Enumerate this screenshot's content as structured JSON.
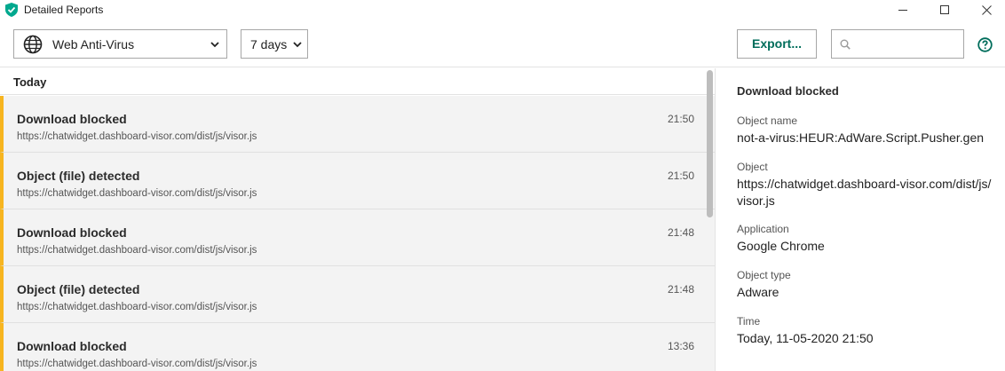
{
  "window": {
    "title": "Detailed Reports"
  },
  "toolbar": {
    "component_selected": "Web Anti-Virus",
    "period_selected": "7 days",
    "export_label": "Export...",
    "search_placeholder": "",
    "search_value": ""
  },
  "list": {
    "group_label": "Today",
    "events": [
      {
        "title": "Download blocked",
        "url": "https://chatwidget.dashboard-visor.com/dist/js/visor.js",
        "time": "21:50"
      },
      {
        "title": "Object (file) detected",
        "url": "https://chatwidget.dashboard-visor.com/dist/js/visor.js",
        "time": "21:50"
      },
      {
        "title": "Download blocked",
        "url": "https://chatwidget.dashboard-visor.com/dist/js/visor.js",
        "time": "21:48"
      },
      {
        "title": "Object (file) detected",
        "url": "https://chatwidget.dashboard-visor.com/dist/js/visor.js",
        "time": "21:48"
      },
      {
        "title": "Download blocked",
        "url": "https://chatwidget.dashboard-visor.com/dist/js/visor.js",
        "time": "13:36"
      }
    ]
  },
  "details": {
    "title": "Download blocked",
    "object_name_label": "Object name",
    "object_name_value": "not-a-virus:HEUR:AdWare.Script.Pusher.gen",
    "object_label": "Object",
    "object_value_line1": "https://chatwidget.dashboard-visor.com/dist/js/",
    "object_value_line2": "visor.js",
    "application_label": "Application",
    "application_value": "Google Chrome",
    "object_type_label": "Object type",
    "object_type_value": "Adware",
    "time_label": "Time",
    "time_value": "Today, 11-05-2020 21:50"
  },
  "colors": {
    "accent": "#006d5b",
    "event_marker": "#f7b520",
    "row_background": "#f3f3f3"
  },
  "icons": {
    "app": "shield-check-icon",
    "component": "globe-icon",
    "dropdown": "chevron-down-icon",
    "search": "search-icon",
    "help": "help-icon",
    "minimize": "minimize-icon",
    "maximize": "maximize-icon",
    "close": "close-icon"
  }
}
